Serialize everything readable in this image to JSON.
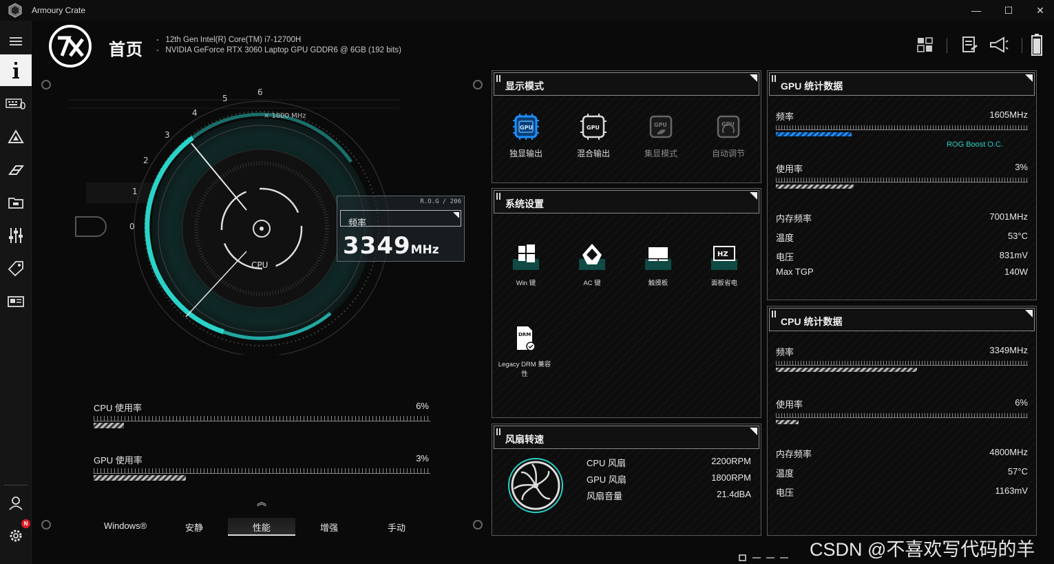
{
  "app": {
    "title": "Armoury Crate"
  },
  "header": {
    "page_title": "首页",
    "specs": [
      "12th Gen Intel(R) Core(TM) i7-12700H",
      "NVIDIA GeForce RTX 3060 Laptop GPU GDDR6 @ 6GB (192 bits)"
    ]
  },
  "dial": {
    "scale_label": "× 1000 MHz",
    "ticks": [
      "0",
      "1",
      "2",
      "3",
      "4",
      "5",
      "6"
    ],
    "center_label": "CPU",
    "freq_label": "频率",
    "freq_value": "3349",
    "freq_unit": "MHz",
    "tag": "R.O.G / 206"
  },
  "usage": {
    "cpu": {
      "label": "CPU 使用率",
      "value": "6%",
      "percent": 6
    },
    "gpu": {
      "label": "GPU 使用率",
      "value": "3%",
      "percent": 3
    }
  },
  "modes": {
    "items": [
      "Windows®",
      "安静",
      "性能",
      "增强",
      "手动"
    ],
    "active": "性能"
  },
  "display_mode": {
    "title": "显示模式",
    "items": [
      {
        "label": "独显输出",
        "state": "active"
      },
      {
        "label": "混合输出",
        "state": "normal"
      },
      {
        "label": "集显模式",
        "state": "disabled"
      },
      {
        "label": "自动调节",
        "state": "disabled"
      }
    ]
  },
  "system_settings": {
    "title": "系统设置",
    "items": [
      {
        "label": "Win 键",
        "icon": "windows-key-icon"
      },
      {
        "label": "AC 键",
        "icon": "ac-key-icon"
      },
      {
        "label": "触摸板",
        "icon": "touchpad-icon"
      },
      {
        "label": "面板省电",
        "icon": "panel-power-saver-icon"
      },
      {
        "label": "Legacy DRM 兼容性",
        "icon": "drm-icon"
      }
    ]
  },
  "fan": {
    "title": "风扇转速",
    "rows": [
      {
        "label": "CPU 风扇",
        "value": "2200RPM"
      },
      {
        "label": "GPU 风扇",
        "value": "1800RPM"
      },
      {
        "label": "风扇音量",
        "value": "21.4dBA"
      }
    ]
  },
  "gpu_stats": {
    "title": "GPU 统计数据",
    "freq": {
      "label": "频率",
      "value": "1605MHz",
      "fill": 0.3
    },
    "boost_label": "ROG Boost O.C.",
    "usage": {
      "label": "使用率",
      "value": "3%",
      "fill": 0.31
    },
    "rows": [
      {
        "label": "内存频率",
        "value": "7001MHz"
      },
      {
        "label": "温度",
        "value": "53°C"
      },
      {
        "label": "电压",
        "value": "831mV"
      },
      {
        "label": "Max TGP",
        "value": "140W"
      }
    ]
  },
  "cpu_stats": {
    "title": "CPU 统计数据",
    "freq": {
      "label": "频率",
      "value": "3349MHz",
      "fill": 0.56
    },
    "usage": {
      "label": "使用率",
      "value": "6%",
      "fill": 0.09
    },
    "rows": [
      {
        "label": "内存频率",
        "value": "4800MHz"
      },
      {
        "label": "温度",
        "value": "57°C"
      },
      {
        "label": "电压",
        "value": "1163mV"
      }
    ]
  },
  "watermark": "CSDN @不喜欢写代码的羊",
  "sidebar": {
    "notification_badge": "N"
  },
  "colors": {
    "accent": "#2ad3c8",
    "accent_blue": "#1e90ff",
    "panel_border": "#5a5a5a"
  }
}
